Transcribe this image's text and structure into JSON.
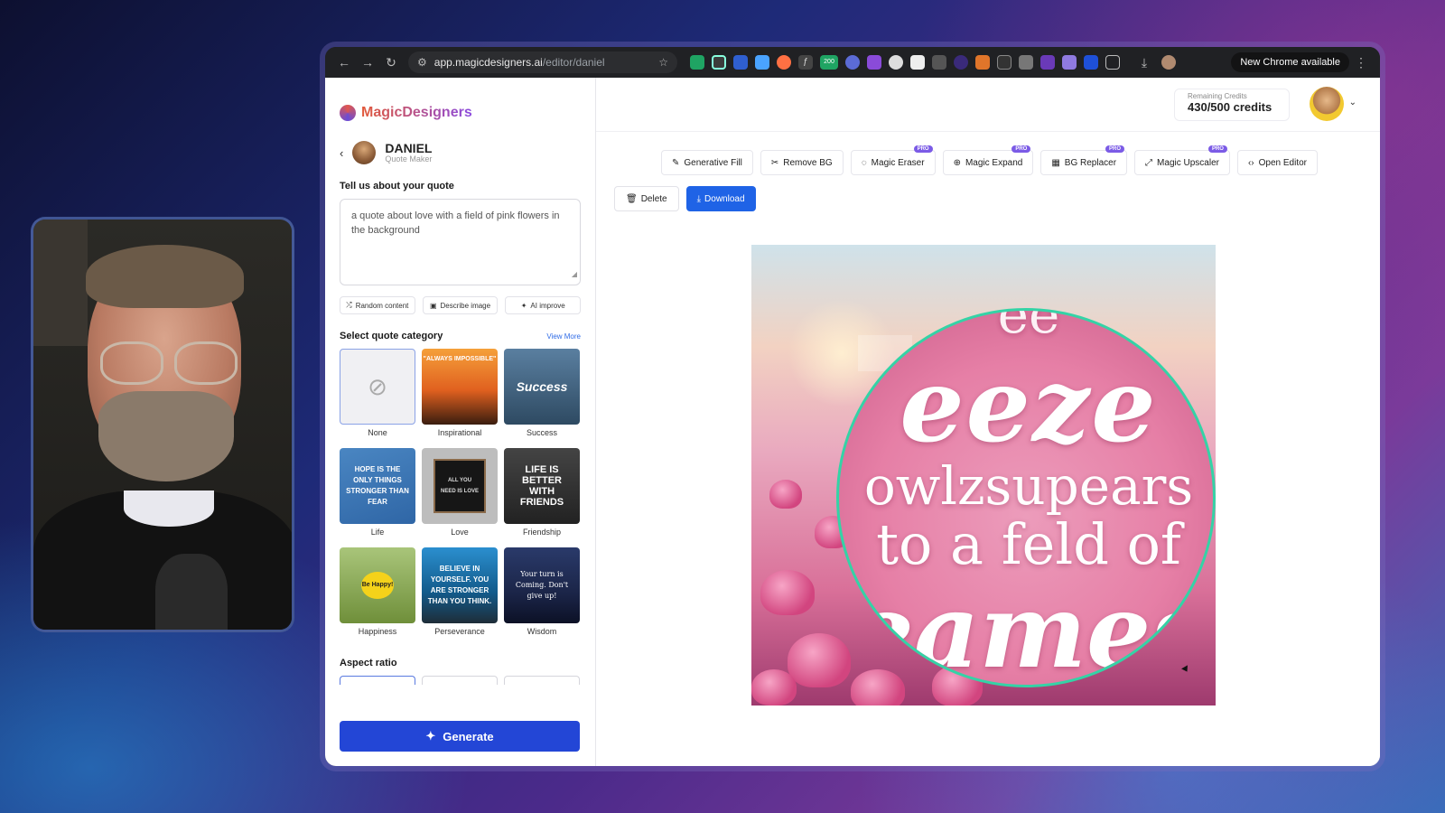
{
  "browser": {
    "url_host": "app.magicdesigners.ai",
    "url_path": "/editor/daniel",
    "new_chrome": "New Chrome available",
    "ext_badge": "200"
  },
  "sidebar": {
    "logo": "MagicDesigners",
    "persona_name": "DANIEL",
    "persona_role": "Quote Maker",
    "quote_title": "Tell us about your quote",
    "quote_text": "a quote about love with a field of pink flowers in the background",
    "btn_random": "Random content",
    "btn_describe": "Describe image",
    "btn_improve": "AI improve",
    "category_title": "Select quote category",
    "view_more": "View More",
    "categories": [
      {
        "label": "None",
        "thumb_text": "⊘"
      },
      {
        "label": "Inspirational",
        "thumb_text": "\"ALWAYS IMPOSSIBLE\""
      },
      {
        "label": "Success",
        "thumb_text": "Success"
      },
      {
        "label": "Life",
        "thumb_text": "HOPE IS THE ONLY THINGS STRONGER THAN FEAR"
      },
      {
        "label": "Love",
        "thumb_text": "ALL YOU NEED IS LOVE"
      },
      {
        "label": "Friendship",
        "thumb_text": "LIFE IS BETTER WITH FRIENDS"
      },
      {
        "label": "Happiness",
        "thumb_text": "Be Happy!"
      },
      {
        "label": "Perseverance",
        "thumb_text": "BELIEVE IN YOURSELF. YOU ARE STRONGER THAN YOU THINK."
      },
      {
        "label": "Wisdom",
        "thumb_text": "Your turn is Coming. Don't give up!"
      }
    ],
    "aspect_title": "Aspect ratio",
    "generate": "Generate"
  },
  "header": {
    "credits_label": "Remaining Credits",
    "credits_value": "430/500 credits"
  },
  "toolbar": {
    "tools": [
      {
        "label": "Generative Fill",
        "pro": ""
      },
      {
        "label": "Remove BG",
        "pro": ""
      },
      {
        "label": "Magic Eraser",
        "pro": "PRO"
      },
      {
        "label": "Magic Expand",
        "pro": "PRO"
      },
      {
        "label": "BG Replacer",
        "pro": "PRO"
      },
      {
        "label": "Magic Upscaler",
        "pro": "PRO"
      },
      {
        "label": "Open Editor",
        "pro": ""
      }
    ],
    "delete": "Delete",
    "download": "Download"
  },
  "canvas": {
    "lines": [
      "ee",
      "eeze",
      "owlzsupears",
      "to a feld of",
      "eames"
    ]
  },
  "colors": {
    "primary": "#2346d6",
    "download": "#1f63e6",
    "pro_badge": "#7b5be6",
    "lens_ring": "#34d3a6"
  }
}
